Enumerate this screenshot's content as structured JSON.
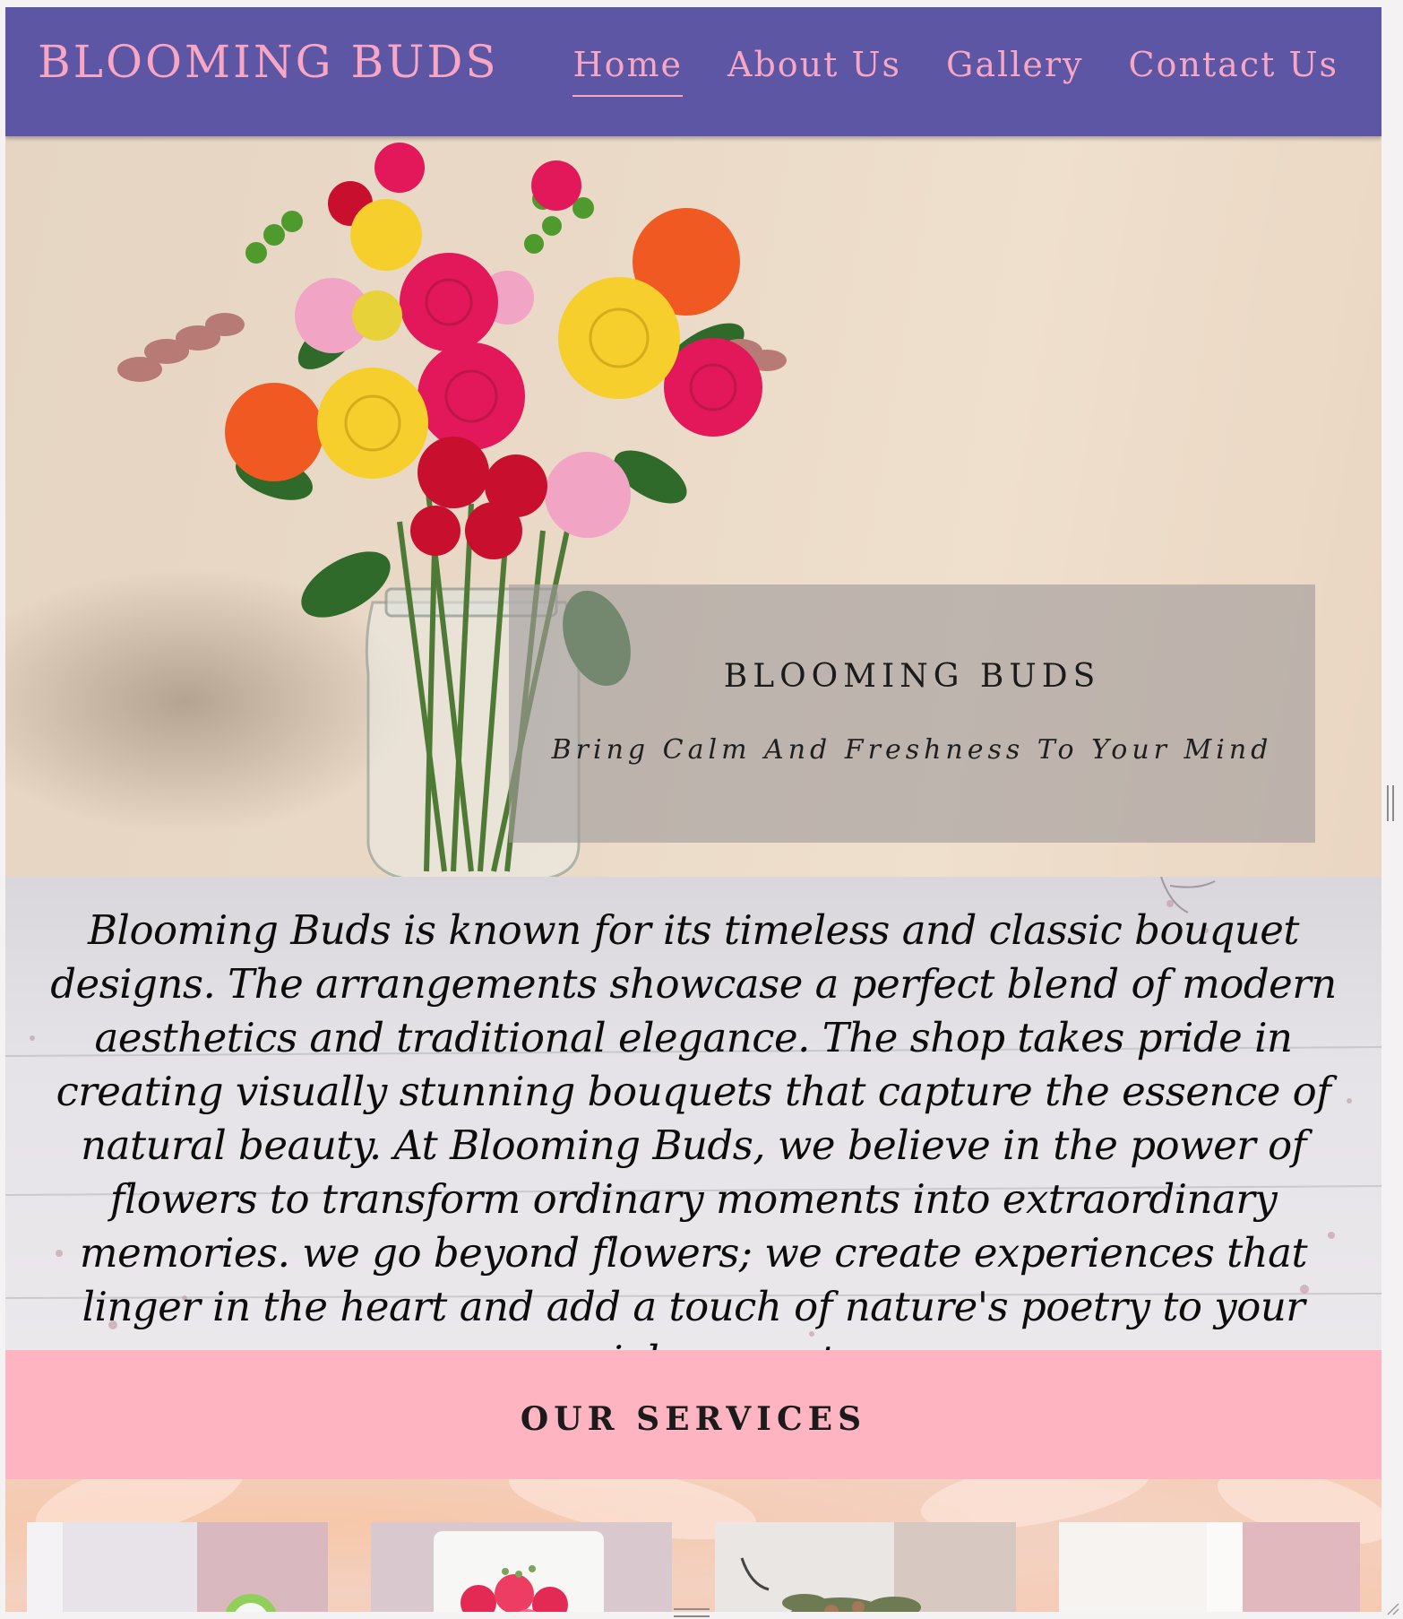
{
  "nav": {
    "brand": "BLOOMING BUDS",
    "links": [
      {
        "label": "Home",
        "active": true
      },
      {
        "label": "About Us",
        "active": false
      },
      {
        "label": "Gallery",
        "active": false
      },
      {
        "label": "Contact Us",
        "active": false
      }
    ]
  },
  "hero": {
    "title": "BLOOMING BUDS",
    "subtitle": "Bring Calm And Freshness To Your Mind"
  },
  "about": {
    "text": "Blooming Buds is known for its timeless and classic bouquet designs. The arrangements showcase a perfect blend of modern aesthetics and traditional elegance. The shop takes pride in creating visually stunning bouquets that capture the essence of natural beauty. At Blooming Buds, we believe in the power of flowers to transform ordinary moments into extraordinary memories. we go beyond flowers; we create experiences that linger in the heart and add a touch of nature's poetry to your special moments."
  },
  "services": {
    "title": "OUR SERVICES",
    "cards": [
      {
        "icon": "service-image-1"
      },
      {
        "icon": "service-image-2"
      },
      {
        "icon": "service-image-3"
      },
      {
        "icon": "service-image-4"
      }
    ]
  },
  "colors": {
    "nav_bg": "#5c56a4",
    "nav_text": "#f7a6c3",
    "services_bar": "#ffb4c1",
    "hero_card": "#a09b9b"
  }
}
